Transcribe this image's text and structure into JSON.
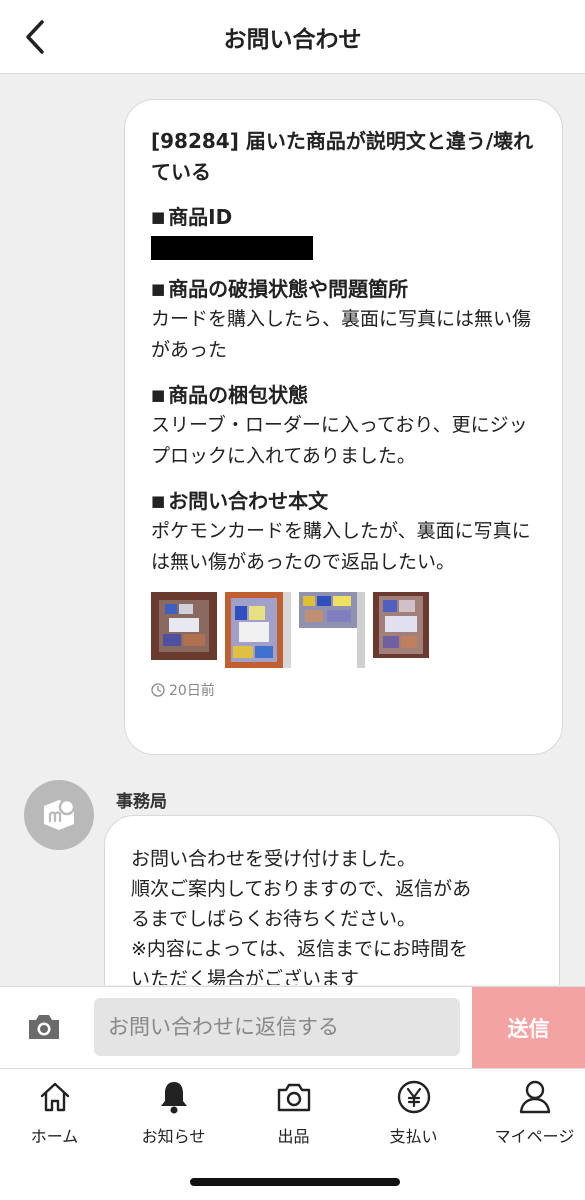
{
  "header": {
    "title": "お問い合わせ"
  },
  "inquiry": {
    "title": "[98284] 届いた商品が説明文と違う/壊れている",
    "sections": [
      {
        "heading": "商品ID",
        "body": ""
      },
      {
        "heading": "商品の破損状態や問題箇所",
        "body": "カードを購入したら、裏面に写真には無い傷があった"
      },
      {
        "heading": "商品の梱包状態",
        "body": "スリーブ・ローダーに入っており、更にジップロックに入れてありました。"
      },
      {
        "heading": "お問い合わせ本文",
        "body": "ポケモンカードを購入したが、裏面に写真には無い傷があったので返品したい。"
      }
    ],
    "bullet": "■",
    "time": "20日前"
  },
  "office": {
    "sender": "事務局",
    "message_lines": [
      "お問い合わせを受け付けました。",
      "順次ご案内しておりますので、返信があ",
      "るまでしばらくお待ちください。",
      "※内容によっては、返信までにお時間を",
      "いただく場合がございます"
    ]
  },
  "input": {
    "placeholder": "お問い合わせに返信する",
    "value": "",
    "send_label": "送信"
  },
  "tabs": [
    {
      "label": "ホーム",
      "icon": "home-icon"
    },
    {
      "label": "お知らせ",
      "icon": "bell-icon"
    },
    {
      "label": "出品",
      "icon": "camera-icon"
    },
    {
      "label": "支払い",
      "icon": "yen-icon"
    },
    {
      "label": "マイページ",
      "icon": "person-icon"
    }
  ],
  "colors": {
    "send_button": "#f4a3a3",
    "background": "#efefef",
    "avatar": "#b9b9b9"
  }
}
